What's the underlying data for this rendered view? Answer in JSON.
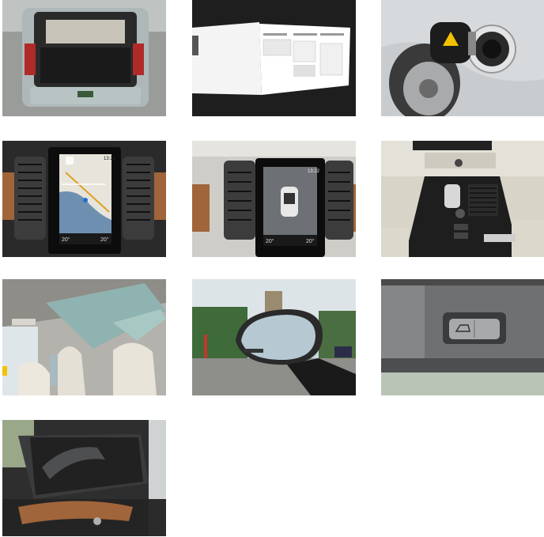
{
  "gallery": {
    "photos": [
      {
        "subject": "open-trunk"
      },
      {
        "subject": "owner-manual"
      },
      {
        "subject": "charging-port"
      },
      {
        "subject": "navigation-screen",
        "screen": {
          "time": "13:22",
          "temp_left": "20°",
          "temp_right": "20°"
        }
      },
      {
        "subject": "parking-camera-screen",
        "screen": {
          "time": "13:22",
          "temp_left": "20°",
          "temp_right": "20°"
        }
      },
      {
        "subject": "center-console"
      },
      {
        "subject": "panoramic-roof"
      },
      {
        "subject": "side-mirror"
      },
      {
        "subject": "tailgate-button"
      },
      {
        "subject": "rear-door-sunshade"
      }
    ]
  },
  "colors": {
    "background": "#ffffff",
    "wood_trim": "#a0653a",
    "screen_map_water": "#6e8fb0",
    "sky": "#c9d6de",
    "warning_yellow": "#f2c200"
  }
}
